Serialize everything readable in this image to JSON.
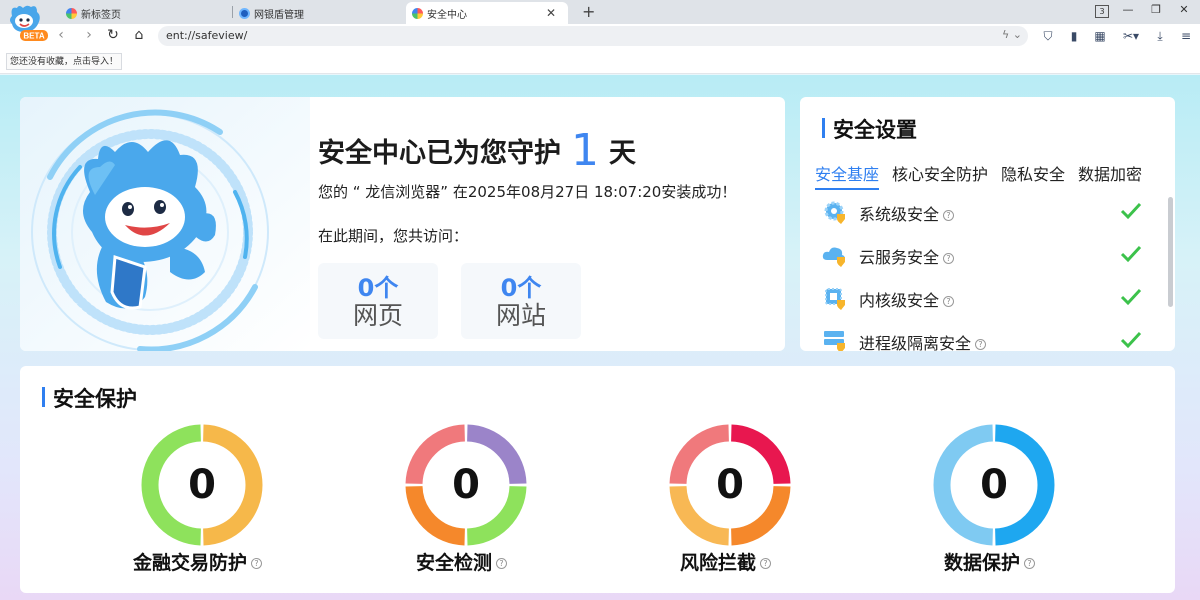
{
  "browser": {
    "logo_badge": "BETA",
    "tabs": [
      {
        "label": "新标签页"
      },
      {
        "label": "网银盾管理"
      },
      {
        "label": "安全中心"
      }
    ],
    "new_tab_symbol": "+",
    "close_symbol": "✕",
    "tab_count": "3",
    "address": "ent://safeview/",
    "bookmark_hint": "您还没有收藏，点击导入！"
  },
  "hero": {
    "title_before": "安全中心已为您守护",
    "days": "1",
    "title_after": "天",
    "install_line": "您的 “ 龙信浏览器” 在2025年08月27日 18:07:20安装成功！",
    "visit_line": "在此期间，您共访问：",
    "stats": [
      {
        "num": "0个",
        "label": "网页"
      },
      {
        "num": "0个",
        "label": "网站"
      }
    ]
  },
  "settings": {
    "title": "安全设置",
    "tabs": [
      "安全基座",
      "核心安全防护",
      "隐私安全",
      "数据加密"
    ],
    "active_tab": "安全基座",
    "items": [
      {
        "label": "系统级安全",
        "icon": "gear-shield-icon",
        "status": "ok"
      },
      {
        "label": "云服务安全",
        "icon": "cloud-shield-icon",
        "status": "ok"
      },
      {
        "label": "内核级安全",
        "icon": "chip-shield-icon",
        "status": "ok"
      },
      {
        "label": "进程级隔离安全",
        "icon": "server-shield-icon",
        "status": "ok"
      }
    ],
    "help_symbol": "?"
  },
  "protection": {
    "title": "安全保护",
    "rings": [
      {
        "label": "金融交易防护",
        "value": "0",
        "colors": [
          "#f6b84a",
          "#8ee25c"
        ]
      },
      {
        "label": "安全检测",
        "value": "0",
        "colors": [
          "#9b84c9",
          "#8ee25c",
          "#f5882b",
          "#f0797c"
        ]
      },
      {
        "label": "风险拦截",
        "value": "0",
        "colors": [
          "#e8174f",
          "#f5882b",
          "#f8b854",
          "#f0797c"
        ]
      },
      {
        "label": "数据保护",
        "value": "0",
        "colors": [
          "#1ea7f0",
          "#7fcaf2"
        ]
      }
    ]
  },
  "colors": {
    "accent": "#2f7ff0",
    "check": "#3cc24b"
  }
}
